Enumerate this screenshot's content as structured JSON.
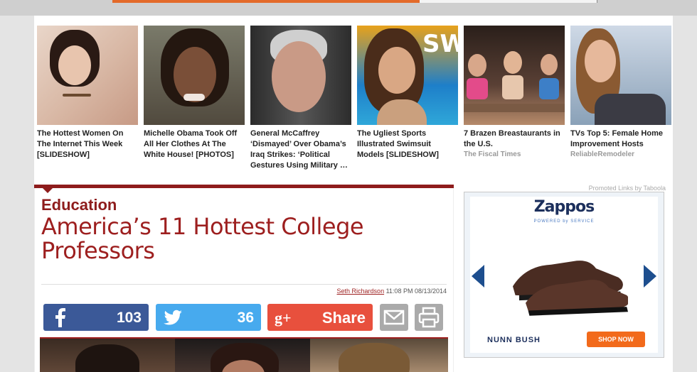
{
  "promos": [
    {
      "title": "The Hottest Women On The Internet This Week [SLIDESHOW]",
      "source": ""
    },
    {
      "title": "Michelle Obama Took Off All Her Clothes At The White House! [PHOTOS]",
      "source": ""
    },
    {
      "title": "General McCaffrey ‘Dismayed’ Over Obama’s Iraq Strikes: ‘Political Gestures Using Military …",
      "source": ""
    },
    {
      "title": "The Ugliest Sports Illustrated Swimsuit Models [SLIDESHOW]",
      "source": ""
    },
    {
      "title": "7 Brazen Breastaurants in the U.S.",
      "source": "The Fiscal Times"
    },
    {
      "title": "TVs Top 5: Female Home Improvement Hosts",
      "source": "ReliableRemodeler"
    }
  ],
  "promo_credit": "Promoted Links by Taboola",
  "article": {
    "category": "Education",
    "headline": "America’s 11 Hottest College Professors",
    "author": "Seth Richardson",
    "timestamp": "11:08 PM 08/13/2014"
  },
  "share": {
    "facebook_count": "103",
    "twitter_count": "36",
    "google_label": "Share"
  },
  "ad": {
    "logo": "Zappos",
    "logo_sub": "POWERED by SERVICE",
    "brand": "NUNN BUSH",
    "cta": "SHOP NOW"
  },
  "colors": {
    "accent": "#8e1c1c",
    "facebook": "#3b5998",
    "twitter": "#47aaee",
    "google": "#e8503d"
  }
}
